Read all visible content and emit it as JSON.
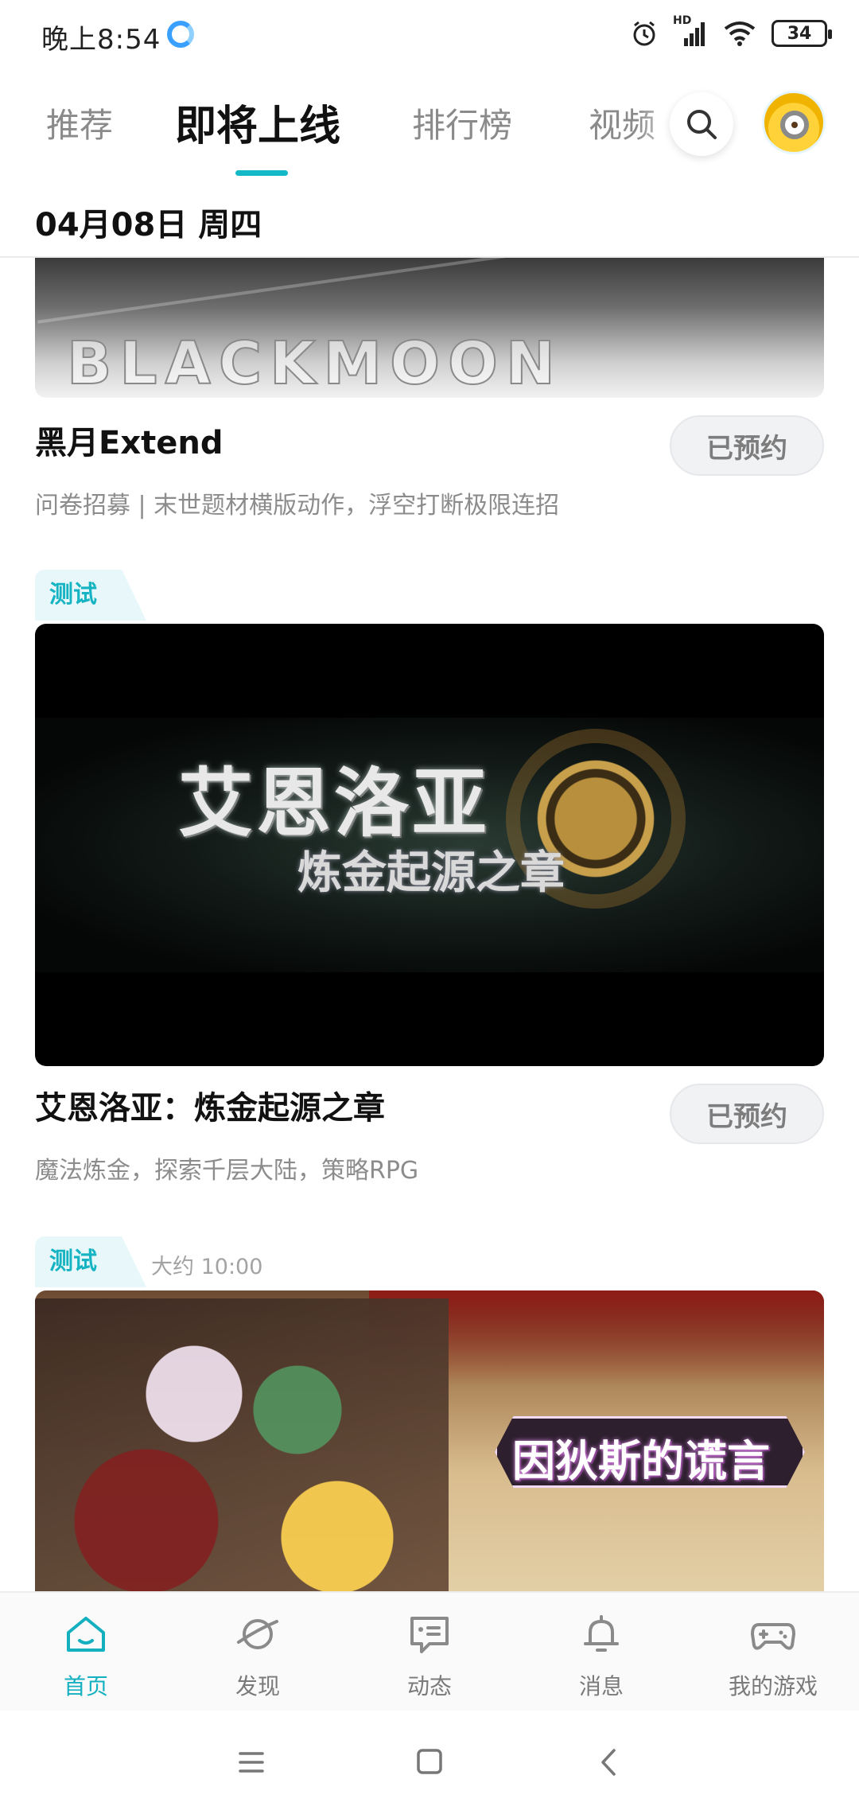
{
  "status_bar": {
    "time": "晚上8:54",
    "network_label": "HD",
    "battery": "34"
  },
  "top_tabs": {
    "tabs": [
      "推荐",
      "即将上线",
      "排行榜",
      "视频"
    ],
    "active_index": 1,
    "accent_color": "#14b9c8"
  },
  "date_header": "04月08日 周四",
  "feed": {
    "items": [
      {
        "banner_wordmark": "BLACKMOON",
        "title": "黑月Extend",
        "description": "问卷招募 | 末世题材横版动作，浮空打断极限连招",
        "button": "已预约"
      },
      {
        "tag": "测试",
        "banner_title": "艾恩洛亚",
        "banner_subtitle": "炼金起源之章",
        "title": "艾恩洛亚：炼金起源之章",
        "description": "魔法炼金，探索千层大陆，策略RPG",
        "button": "已预约"
      },
      {
        "tag": "测试",
        "time": "大约 10:00",
        "banner_logo": "因狄斯的谎言"
      }
    ]
  },
  "bottom_nav": {
    "items": [
      {
        "label": "首页",
        "icon": "home-icon",
        "active": true
      },
      {
        "label": "发现",
        "icon": "planet-icon",
        "active": false
      },
      {
        "label": "动态",
        "icon": "chat-icon",
        "active": false
      },
      {
        "label": "消息",
        "icon": "bell-icon",
        "active": false
      },
      {
        "label": "我的游戏",
        "icon": "gamepad-icon",
        "active": false
      }
    ],
    "active_color": "#15b0c0"
  }
}
